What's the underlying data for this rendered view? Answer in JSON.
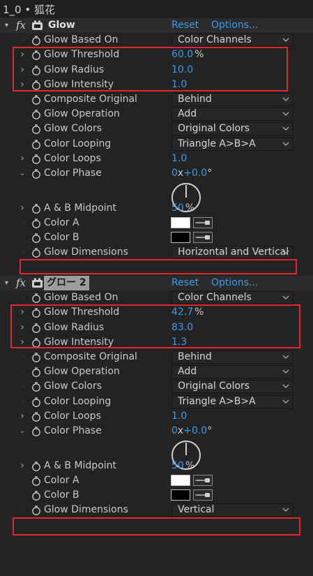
{
  "titlebar": {
    "text": "1_0 • 狐花"
  },
  "effects": [
    {
      "name": "Glow",
      "reset_label": "Reset",
      "options_label": "Options...",
      "params": [
        {
          "label": "Glow Based On",
          "kind": "dropdown",
          "value": "Color Channels"
        },
        {
          "label": "Glow Threshold",
          "kind": "number",
          "value": "60.0",
          "unit": "%",
          "twirl": true
        },
        {
          "label": "Glow Radius",
          "kind": "number",
          "value": "10.0",
          "twirl": true
        },
        {
          "label": "Glow Intensity",
          "kind": "number",
          "value": "1.0",
          "twirl": true
        },
        {
          "label": "Composite Original",
          "kind": "dropdown",
          "value": "Behind"
        },
        {
          "label": "Glow Operation",
          "kind": "dropdown",
          "value": "Add"
        },
        {
          "label": "Glow Colors",
          "kind": "dropdown",
          "value": "Original Colors"
        },
        {
          "label": "Color Looping",
          "kind": "dropdown",
          "value": "Triangle A>B>A"
        },
        {
          "label": "Color Loops",
          "kind": "number",
          "value": "1.0",
          "twirl": true
        },
        {
          "label": "Color Phase",
          "kind": "angle",
          "revs": "0",
          "x": "x",
          "deg": "+0.0",
          "degsym": "°",
          "twirl": "open"
        },
        {
          "label": "A & B Midpoint",
          "kind": "number",
          "value": "50",
          "unit": "%",
          "twirl": true
        },
        {
          "label": "Color A",
          "kind": "color",
          "color": "#ffffff"
        },
        {
          "label": "Color B",
          "kind": "color",
          "color": "#000000"
        },
        {
          "label": "Glow Dimensions",
          "kind": "dropdown",
          "value": "Horizontal and Vertical"
        }
      ]
    },
    {
      "name": "グロー 2",
      "highlighted": true,
      "reset_label": "Reset",
      "options_label": "Options...",
      "params": [
        {
          "label": "Glow Based On",
          "kind": "dropdown",
          "value": "Color Channels"
        },
        {
          "label": "Glow Threshold",
          "kind": "number",
          "value": "42.7",
          "unit": "%",
          "twirl": true
        },
        {
          "label": "Glow Radius",
          "kind": "number",
          "value": "83.0",
          "twirl": true
        },
        {
          "label": "Glow Intensity",
          "kind": "number",
          "value": "1.3",
          "twirl": true
        },
        {
          "label": "Composite Original",
          "kind": "dropdown",
          "value": "Behind"
        },
        {
          "label": "Glow Operation",
          "kind": "dropdown",
          "value": "Add"
        },
        {
          "label": "Glow Colors",
          "kind": "dropdown",
          "value": "Original Colors"
        },
        {
          "label": "Color Looping",
          "kind": "dropdown",
          "value": "Triangle A>B>A"
        },
        {
          "label": "Color Loops",
          "kind": "number",
          "value": "1.0",
          "twirl": true
        },
        {
          "label": "Color Phase",
          "kind": "angle",
          "revs": "0",
          "x": "x",
          "deg": "+0.0",
          "degsym": "°",
          "twirl": "open"
        },
        {
          "label": "A & B Midpoint",
          "kind": "number",
          "value": "50",
          "unit": "%",
          "twirl": true
        },
        {
          "label": "Color A",
          "kind": "color",
          "color": "#ffffff"
        },
        {
          "label": "Color B",
          "kind": "color",
          "color": "#000000"
        },
        {
          "label": "Glow Dimensions",
          "kind": "dropdown",
          "value": "Vertical"
        }
      ]
    }
  ],
  "colors": {
    "accent": "#3d9bea",
    "highlight_box": "#e0262f",
    "panel": "#232323"
  },
  "icons": {
    "stopwatch": "stopwatch-icon",
    "effect_badge": "effect-badge-icon",
    "dropdown": "chevron-down-icon",
    "eyedropper": "eyedropper-icon"
  }
}
